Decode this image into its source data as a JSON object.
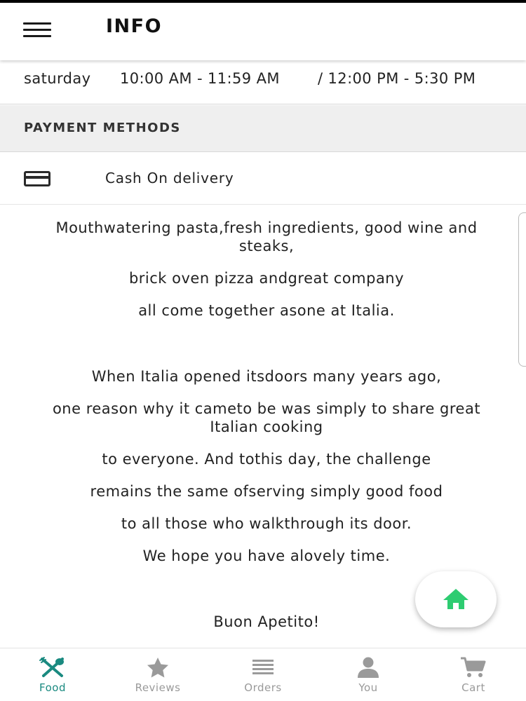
{
  "appbar": {
    "title": "INFO"
  },
  "hours": {
    "day": "saturday",
    "slot1": "10:00 AM - 11:59 AM",
    "slot2": "/ 12:00 PM - 5:30 PM"
  },
  "payment": {
    "header": "PAYMENT METHODS",
    "method": "Cash On delivery",
    "icon": "credit-card-icon"
  },
  "about": {
    "lines": [
      "Mouthwatering pasta,fresh ingredients, good wine and steaks,",
      "brick oven pizza andgreat company",
      "all come together asone at Italia.",
      "When Italia opened itsdoors many years ago,",
      "one reason why it cameto be was simply to share great Italian cooking",
      "to everyone. And tothis day, the challenge",
      "remains the same ofserving simply good food",
      "to all those who walkthrough its door.",
      "We hope you have alovely time.",
      "Buon Apetito!"
    ]
  },
  "fab": {
    "icon": "home-icon",
    "color": "#2ecc71"
  },
  "bottom_nav": {
    "active_color": "#1a8a80",
    "inactive_color": "#9a9a9a",
    "items": [
      {
        "label": "Food",
        "icon": "fork-knife-icon",
        "active": true
      },
      {
        "label": "Reviews",
        "icon": "star-icon",
        "active": false
      },
      {
        "label": "Orders",
        "icon": "list-icon",
        "active": false
      },
      {
        "label": "You",
        "icon": "person-icon",
        "active": false
      },
      {
        "label": "Cart",
        "icon": "cart-icon",
        "active": false
      }
    ]
  }
}
